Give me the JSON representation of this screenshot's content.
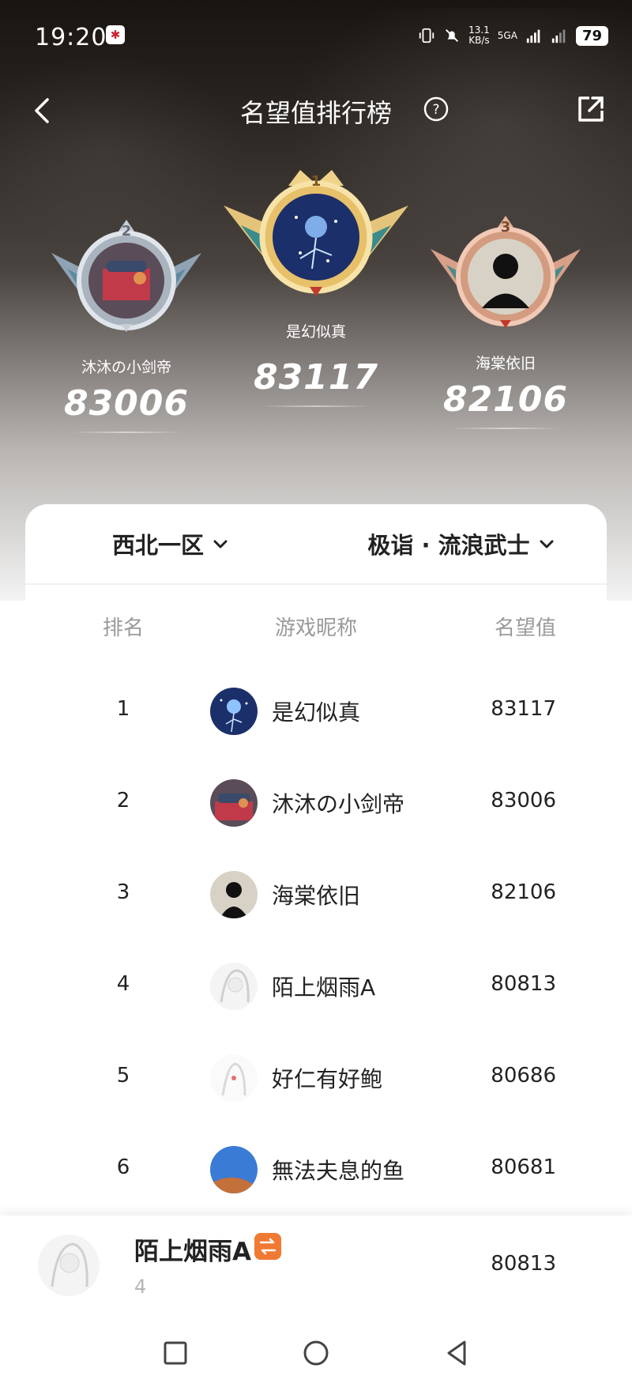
{
  "status_bar": {
    "time": "19:20",
    "network_speed": "13.1\nKB/s",
    "network_type": "5GA",
    "battery": "79"
  },
  "header": {
    "title": "名望值排行榜"
  },
  "podium": [
    {
      "place": "2",
      "name": "沐沐の小剑帝",
      "score": "83006"
    },
    {
      "place": "1",
      "name": "是幻似真",
      "score": "83117"
    },
    {
      "place": "3",
      "name": "海棠依旧",
      "score": "82106"
    }
  ],
  "filters": {
    "region": "西北一区",
    "hero": "极诣 · 流浪武士"
  },
  "table": {
    "columns": {
      "rank": "排名",
      "nickname": "游戏昵称",
      "score": "名望值"
    },
    "rows": [
      {
        "rank": "1",
        "name": "是幻似真",
        "score": "83117"
      },
      {
        "rank": "2",
        "name": "沐沐の小剑帝",
        "score": "83006"
      },
      {
        "rank": "3",
        "name": "海棠依旧",
        "score": "82106"
      },
      {
        "rank": "4",
        "name": "陌上烟雨A",
        "score": "80813"
      },
      {
        "rank": "5",
        "name": "好仁有好鲍",
        "score": "80686"
      },
      {
        "rank": "6",
        "name": "無法夫息的鱼",
        "score": "80681"
      }
    ]
  },
  "my_entry": {
    "name": "陌上烟雨A",
    "rank": "4",
    "score": "80813"
  },
  "colors": {
    "gold": "#e9c46a",
    "silver": "#b7c0c9",
    "bronze": "#d89a7a",
    "tag_orange": "#f07a33"
  }
}
